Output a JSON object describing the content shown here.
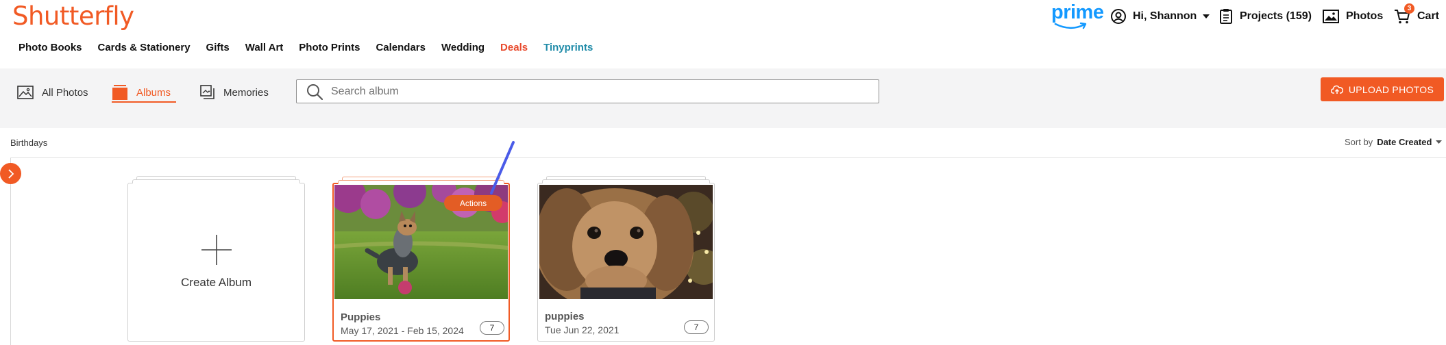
{
  "brand": {
    "logo": "Shutterfly",
    "accent": "#f15a24"
  },
  "header": {
    "prime": "prime",
    "user_greeting": "Hi, Shannon",
    "projects_label": "Projects (159)",
    "photos_label": "Photos",
    "cart_label": "Cart",
    "cart_count": "3"
  },
  "category_nav": [
    {
      "label": "Photo Books"
    },
    {
      "label": "Cards & Stationery"
    },
    {
      "label": "Gifts"
    },
    {
      "label": "Wall Art"
    },
    {
      "label": "Photo Prints"
    },
    {
      "label": "Calendars"
    },
    {
      "label": "Wedding"
    },
    {
      "label": "Deals"
    },
    {
      "label": "Tinyprints"
    }
  ],
  "toolbar": {
    "tabs": [
      {
        "label": "All Photos",
        "icon": "image-icon"
      },
      {
        "label": "Albums",
        "icon": "albums-icon",
        "active": true
      },
      {
        "label": "Memories",
        "icon": "memories-icon"
      }
    ],
    "search_placeholder": "Search album",
    "upload_label": "UPLOAD PHOTOS"
  },
  "section": {
    "title": "Birthdays",
    "sort_prefix": "Sort by",
    "sort_value": "Date Created"
  },
  "albums": [
    {
      "type": "create",
      "label": "Create Album"
    },
    {
      "name": "Puppies",
      "dates": "May 17, 2021 - Feb 15, 2024",
      "count": "7",
      "actions_label": "Actions",
      "selected": true
    },
    {
      "name": "puppies",
      "dates": "Tue Jun 22, 2021",
      "count": "7"
    }
  ]
}
